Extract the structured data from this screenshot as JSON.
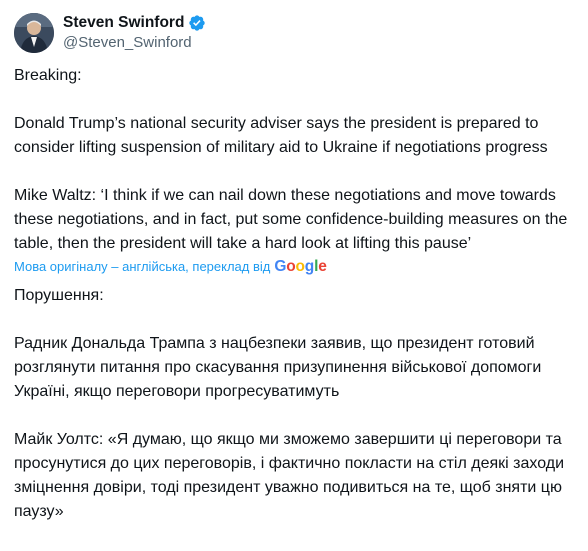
{
  "author": {
    "name": "Steven Swinford",
    "handle": "@Steven_Swinford",
    "verified_icon": "verified-badge-icon"
  },
  "original": {
    "p1": "Breaking:",
    "p2": "Donald Trump’s national security adviser says the president is prepared to consider lifting suspension of military aid to Ukraine if negotiations progress",
    "p3": "Mike Waltz: ‘I think if we can nail down these negotiations and move towards these negotiations, and in fact, put some confidence-building measures on the table, then the president will take a hard look at lifting this pause’"
  },
  "translation_notice": {
    "text": "Мова оригіналу – англійська, переклад від",
    "brand": [
      "G",
      "o",
      "o",
      "g",
      "l",
      "e"
    ]
  },
  "translated": {
    "p1": "Порушення:",
    "p2": "Радник Дональда Трампа з нацбезпеки заявив, що президент готовий розглянути питання про скасування призупинення військової допомоги Україні, якщо переговори прогресуватимуть",
    "p3": "Майк Уолтс: «Я думаю, що якщо ми зможемо завершити ці переговори та просунутися до цих переговорів, і фактично покласти на стіл деякі заходи зміцнення довіри, тоді президент уважно подивиться на те, щоб зняти цю паузу»"
  },
  "colors": {
    "link": "#1d9bf0",
    "text": "#0f1419",
    "secondary": "#536471"
  }
}
